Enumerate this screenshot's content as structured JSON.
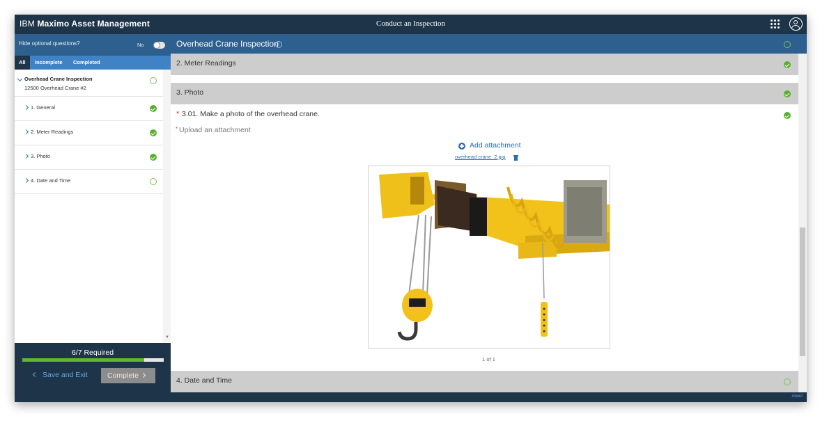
{
  "header": {
    "brand_ibm": "IBM",
    "brand_product": "Maximo Asset Management",
    "page_title": "Conduct an Inspection",
    "apps_icon": "grid-icon",
    "user_icon": "user-avatar-icon"
  },
  "options": {
    "hide_optional_label": "Hide optional questions?",
    "hide_optional_value": "No",
    "hide_optional_on": false
  },
  "filters": [
    {
      "label": "All",
      "active": true
    },
    {
      "label": "Incomplete",
      "active": false
    },
    {
      "label": "Completed",
      "active": false
    }
  ],
  "tree": {
    "root_title": "Overhead Crane Inspection",
    "root_subtitle": "12500 Overhead Crane #2",
    "root_status": "incomplete",
    "items": [
      {
        "label": "1. General",
        "status": "complete"
      },
      {
        "label": "2. Meter Readings",
        "status": "complete"
      },
      {
        "label": "3. Photo",
        "status": "complete"
      },
      {
        "label": "4. Date and Time",
        "status": "incomplete"
      }
    ]
  },
  "footer": {
    "required_text": "6/7 Required",
    "progress": 0.86,
    "save_exit_label": "Save and Exit",
    "complete_label": "Complete"
  },
  "main": {
    "inspection_title": "Overhead Crane Inspection",
    "info_icon": "info-icon",
    "sections": [
      {
        "title": "2. Meter Readings",
        "status": "complete"
      },
      {
        "title": "3. Photo",
        "status": "complete"
      },
      {
        "title": "4. Date and Time",
        "status": "incomplete"
      }
    ],
    "question_text": "3.01. Make a photo of the overhead crane.",
    "upload_label": "Upload an attachment",
    "add_attachment_label": "Add attachment",
    "attachment_filename": "overhead crane_2.jpg",
    "pager_text": "1 of 1"
  },
  "bottom": {
    "about_label": "About"
  },
  "colors": {
    "header_bg": "#1d3449",
    "section_header_bg": "#2d5f8f",
    "filter_bar_bg": "#3f83c6",
    "complete_green": "#57b12c",
    "link_blue": "#2d6db3",
    "crane_yellow": "#f2c21b"
  }
}
